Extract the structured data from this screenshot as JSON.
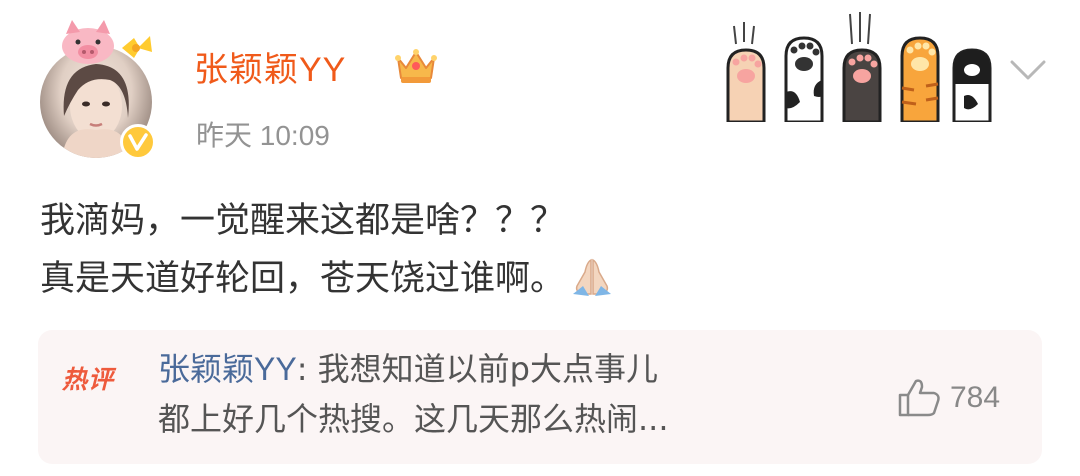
{
  "post": {
    "author": {
      "name": "张颖颖YY",
      "avatar_icon": "avatar-with-pig-ears",
      "verified_icon": "verified-v-badge-icon",
      "vip_icon": "crown-icon",
      "name_color": "#f05a1a"
    },
    "timestamp": "昨天 10:09",
    "decoration_icon": "cat-paws-icon",
    "menu_icon": "chevron-down-icon",
    "content": {
      "lines": [
        "我滴妈，一觉醒来这都是啥？？？",
        "真是天道好轮回，苍天饶过谁啊。"
      ],
      "emoji_icon": "pray-icon"
    }
  },
  "hot_comment": {
    "badge": "热评",
    "author": "张颖颖YY",
    "separator": ": ",
    "lines": [
      "我想知道以前p大点事儿",
      "都上好几个热搜。这几天那么热闹..."
    ],
    "like_icon": "thumb-up-icon",
    "like_count": "784",
    "badge_color": "#ee5a3c",
    "author_color": "#4a6a9a",
    "background_color": "#fbf5f5"
  }
}
